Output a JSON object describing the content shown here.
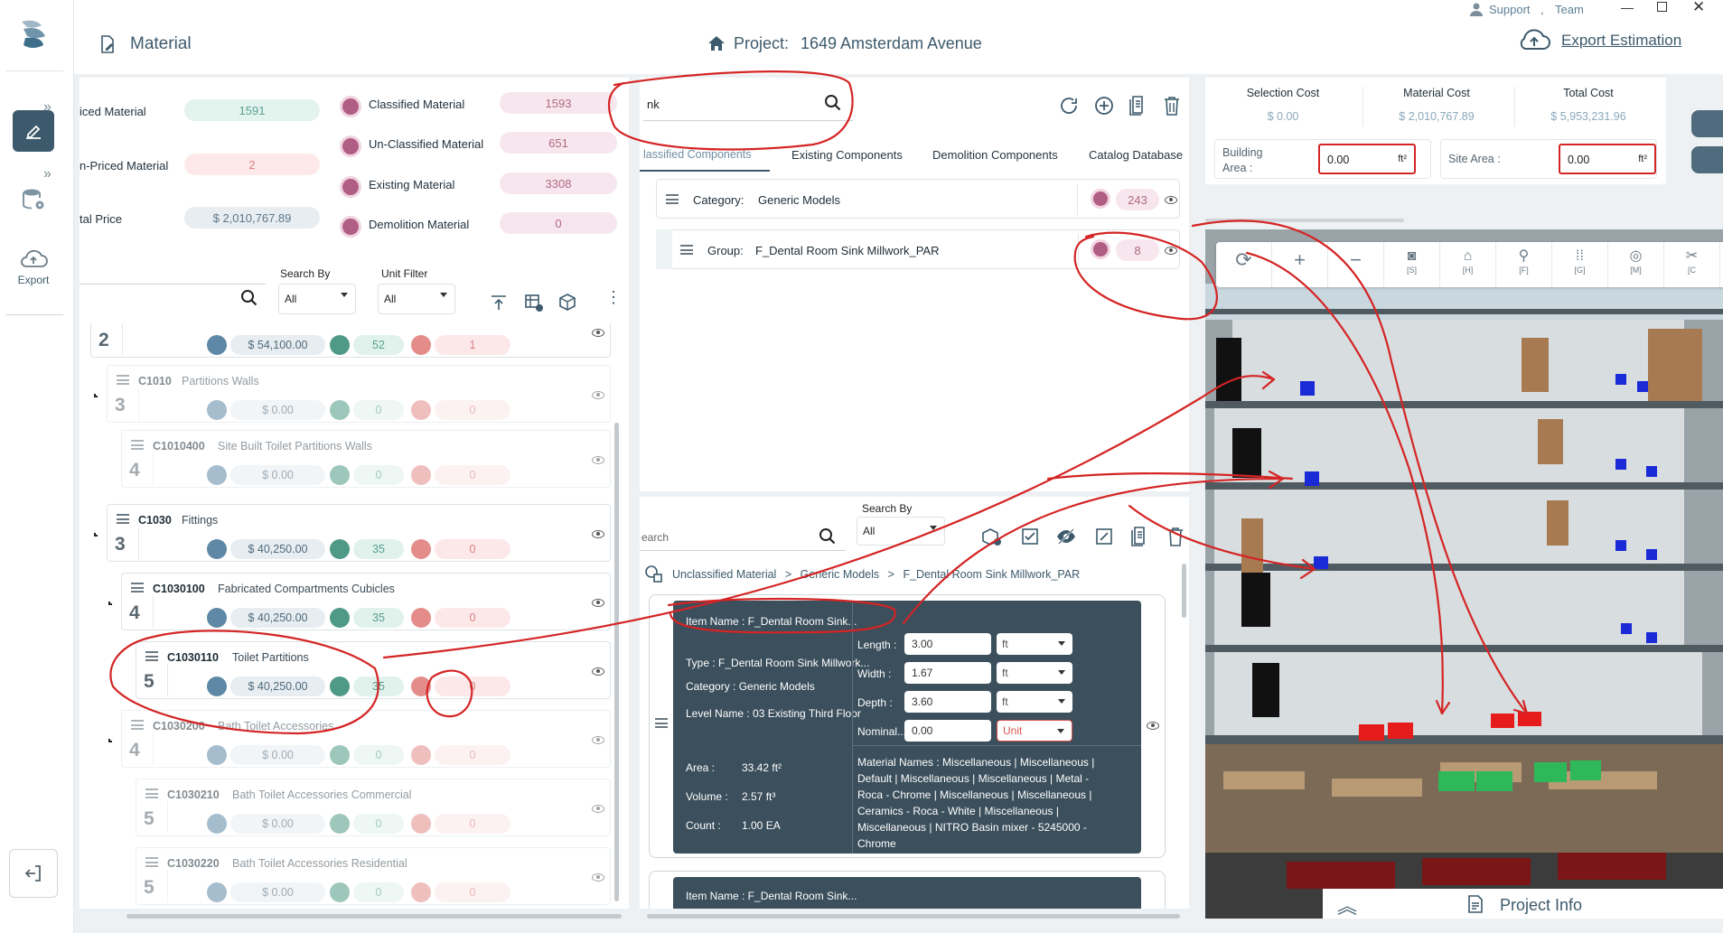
{
  "header": {
    "page_title": "Material",
    "project_label": "Project:",
    "project_name": "1649 Amsterdam Avenue",
    "user_support": "Support",
    "user_separator": ",",
    "user_team": "Team",
    "export_estimation": "Export Estimation"
  },
  "rail": {
    "export_label": "Export"
  },
  "stats_left": [
    {
      "label": "iced Material",
      "value": "1591",
      "tone": "green"
    },
    {
      "label": "n-Priced Material",
      "value": "2",
      "tone": "red"
    },
    {
      "label": "tal Price",
      "value": "$ 2,010,767.89",
      "tone": "blue"
    }
  ],
  "stats_right": [
    {
      "label": "Classified Material",
      "value": "1593"
    },
    {
      "label": "Un-Classified Material",
      "value": "651"
    },
    {
      "label": "Existing Material",
      "value": "3308"
    },
    {
      "label": "Demolition Material",
      "value": "0"
    }
  ],
  "filters": {
    "search_by_label": "Search By",
    "search_by_value": "All",
    "unit_filter_label": "Unit Filter",
    "unit_filter_value": "All"
  },
  "tree": [
    {
      "level": "2",
      "code": "",
      "name": "",
      "price": "$ 54,100.00",
      "count": "52",
      "rejected": "1",
      "dim": false
    },
    {
      "level": "3",
      "code": "C1010",
      "name": "Partitions Walls",
      "price": "$ 0.00",
      "count": "0",
      "rejected": "0",
      "dim": true
    },
    {
      "level": "4",
      "code": "C1010400",
      "name": "Site Built Toilet Partitions Walls",
      "price": "$ 0.00",
      "count": "0",
      "rejected": "0",
      "dim": true
    },
    {
      "level": "3",
      "code": "C1030",
      "name": "Fittings",
      "price": "$ 40,250.00",
      "count": "35",
      "rejected": "0",
      "dim": false
    },
    {
      "level": "4",
      "code": "C1030100",
      "name": "Fabricated Compartments Cubicles",
      "price": "$ 40,250.00",
      "count": "35",
      "rejected": "0",
      "dim": false
    },
    {
      "level": "5",
      "code": "C1030110",
      "name": "Toilet Partitions",
      "price": "$ 40,250.00",
      "count": "35",
      "rejected": "0",
      "dim": false
    },
    {
      "level": "4",
      "code": "C1030200",
      "name": "Bath Toilet Accessories",
      "price": "$ 0.00",
      "count": "0",
      "rejected": "0",
      "dim": true
    },
    {
      "level": "5",
      "code": "C1030210",
      "name": "Bath Toilet Accessories Commercial",
      "price": "$ 0.00",
      "count": "0",
      "rejected": "0",
      "dim": true
    },
    {
      "level": "5",
      "code": "C1030220",
      "name": "Bath Toilet Accessories Residential",
      "price": "$ 0.00",
      "count": "0",
      "rejected": "0",
      "dim": true
    }
  ],
  "middle": {
    "search_value": "nk",
    "tabs": [
      "lassified Components",
      "Existing Components",
      "Demolition Components",
      "Catalog Database"
    ],
    "category_label": "Category:",
    "category_value": "Generic Models",
    "category_count": "243",
    "group_label": "Group:",
    "group_value": "F_Dental Room Sink Millwork_PAR",
    "group_count": "8",
    "lower_search_placeholder": "earch",
    "lower_search_by_label": "Search By",
    "lower_search_by_value": "All",
    "breadcrumb": [
      "Unclassified Material",
      "Generic Models",
      "F_Dental Room Sink Millwork_PAR"
    ],
    "breadcrumb_sep": ">",
    "item": {
      "item_name": "Item Name : F_Dental Room Sink...",
      "type": "Type : F_Dental Room Sink Millwork...",
      "category": "Category : Generic Models",
      "level_name": "Level Name : 03 Existing Third Floor",
      "area_label": "Area :",
      "area_value": "33.42 ft²",
      "volume_label": "Volume :",
      "volume_value": "2.57 ft³",
      "count_label": "Count :",
      "count_value": "1.00 EA",
      "length_label": "Length :",
      "length_value": "3.00",
      "width_label": "Width :",
      "width_value": "1.67",
      "depth_label": "Depth :",
      "depth_value": "3.60",
      "nominal_label": "Nominal...",
      "nominal_value": "0.00",
      "unit_ft": "ft",
      "unit_placeholder": "Unit",
      "material_names": "Material Names : Miscellaneous | Miscellaneous | Default | Miscellaneous | Miscellaneous | Metal - Roca - Chrome | Miscellaneous | Miscellaneous | Ceramics - Roca - White | Miscellaneous | Miscellaneous | NITRO Basin mixer  - 5245000 - Chrome"
    },
    "item2_name": "Item Name : F_Dental Room Sink..."
  },
  "costs": {
    "selection_label": "Selection Cost",
    "selection_value": "$ 0.00",
    "material_label": "Material Cost",
    "material_value": "$ 2,010,767.89",
    "total_label": "Total Cost",
    "total_value": "$ 5,953,231.96",
    "building_area_label": "Building Area :",
    "building_area_value": "0.00",
    "site_area_label": "Site Area :",
    "site_area_value": "0.00",
    "area_unit": "ft²"
  },
  "viewer": {
    "toolbar": [
      {
        "icon": "refresh-icon",
        "key": ""
      },
      {
        "icon": "plus-icon",
        "key": ""
      },
      {
        "icon": "minus-icon",
        "key": ""
      },
      {
        "icon": "camera-icon",
        "key": "[S]"
      },
      {
        "icon": "home-icon",
        "key": "[H]"
      },
      {
        "icon": "pin-icon",
        "key": "[F]"
      },
      {
        "icon": "grid-icon",
        "key": "[G]"
      },
      {
        "icon": "measure-icon",
        "key": "[M]"
      },
      {
        "icon": "tool-icon",
        "key": "[C"
      }
    ],
    "project_info": "Project Info"
  },
  "colors": {
    "accent": "#3d5a6c",
    "dark_card": "#3b4f5c",
    "annotation_red": "#d42424",
    "green_pill": "#e3f3ee",
    "red_pill": "#fde9ea"
  }
}
